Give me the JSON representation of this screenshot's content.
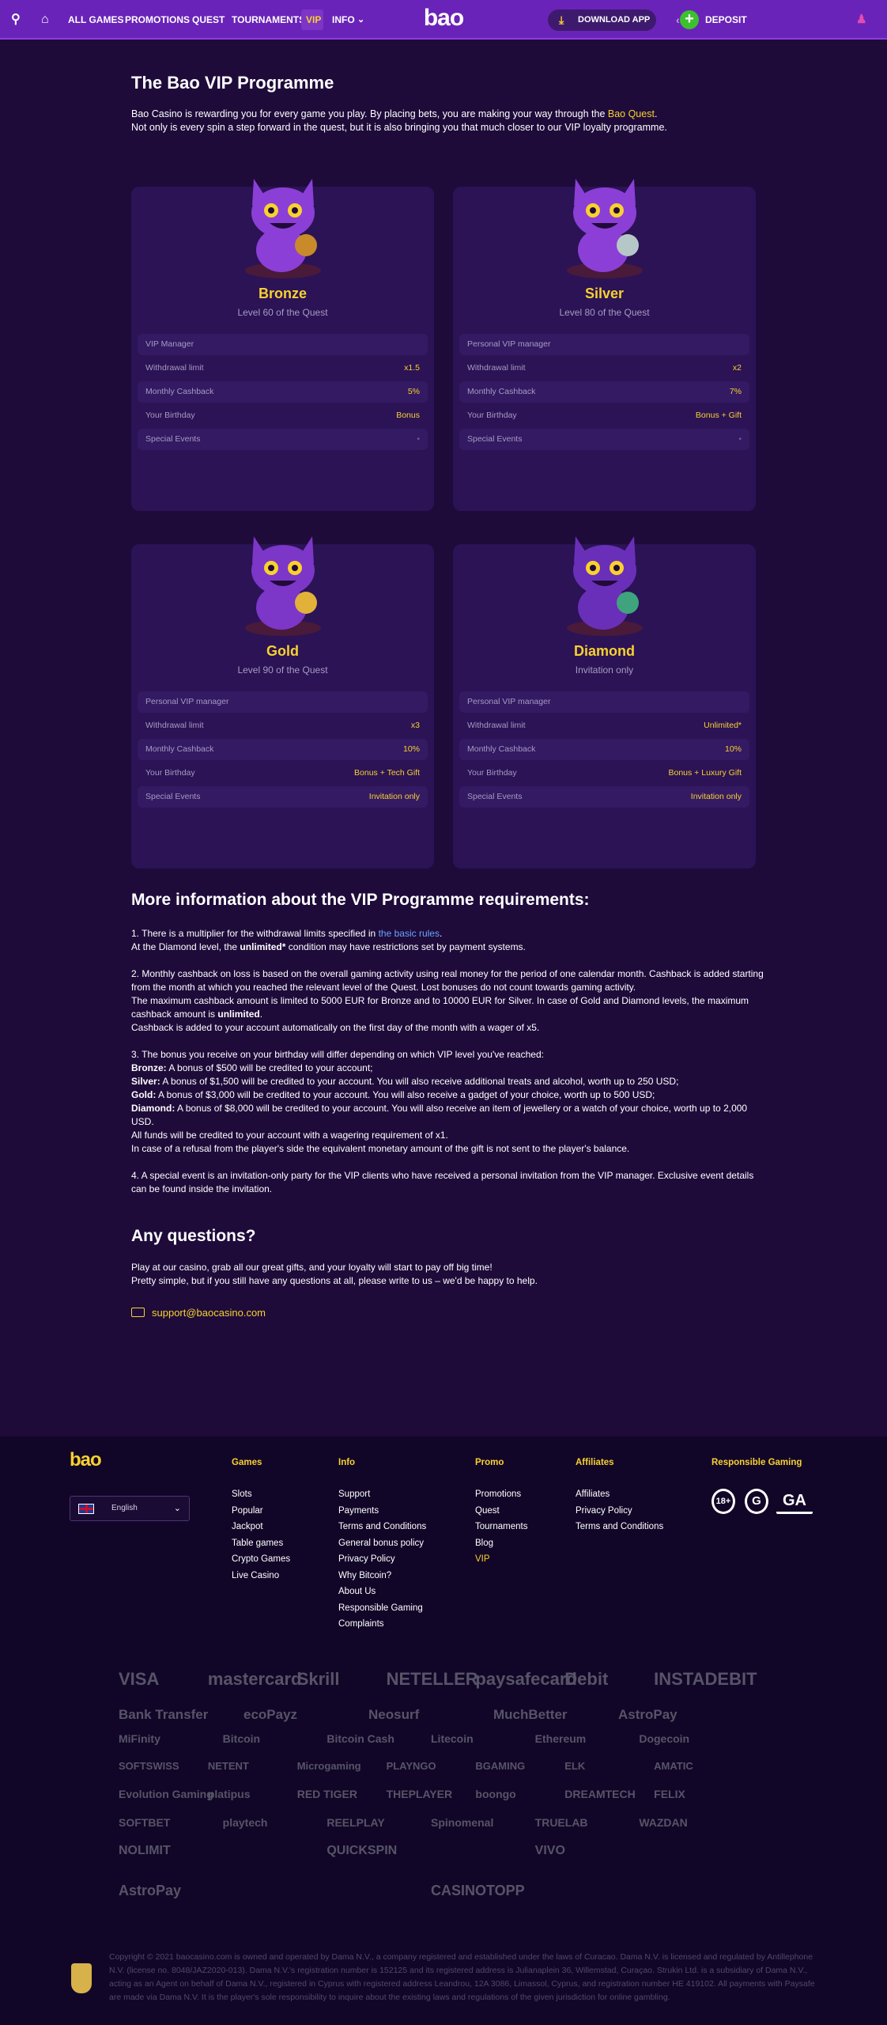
{
  "header": {
    "nav": [
      "ALL GAMES",
      "PROMOTIONS",
      "QUEST",
      "TOURNAMENTS",
      "VIP",
      "INFO"
    ],
    "logo": "bao",
    "download": "DOWNLOAD APP",
    "deposit": "DEPOSIT"
  },
  "page": {
    "title": "The Bao VIP Programme",
    "intro_1": "Bao Casino is rewarding you for every game you play. By placing bets, you are making your way through the ",
    "intro_link": "Bao Quest",
    "intro_2": "Not only is every spin a step forward in the quest, but it is also bringing you that much closer to our VIP loyalty programme."
  },
  "levels": [
    {
      "name": "Bronze",
      "sub": "Level 60 of the Quest",
      "rows": [
        [
          "VIP Manager",
          ""
        ],
        [
          "Withdrawal limit",
          "x1.5"
        ],
        [
          "Monthly Cashback",
          "5%"
        ],
        [
          "Your Birthday",
          "Bonus"
        ],
        [
          "Special Events",
          "•"
        ]
      ]
    },
    {
      "name": "Silver",
      "sub": "Level 80 of the Quest",
      "rows": [
        [
          "Personal VIP manager",
          ""
        ],
        [
          "Withdrawal limit",
          "x2"
        ],
        [
          "Monthly Cashback",
          "7%"
        ],
        [
          "Your Birthday",
          "Bonus + Gift"
        ],
        [
          "Special Events",
          "•"
        ]
      ]
    },
    {
      "name": "Gold",
      "sub": "Level 90 of the Quest",
      "rows": [
        [
          "Personal VIP manager",
          ""
        ],
        [
          "Withdrawal limit",
          "x3"
        ],
        [
          "Monthly Cashback",
          "10%"
        ],
        [
          "Your Birthday",
          "Bonus + Tech Gift"
        ],
        [
          "Special Events",
          "Invitation only"
        ]
      ]
    },
    {
      "name": "Diamond",
      "sub": "Invitation only",
      "rows": [
        [
          "Personal VIP manager",
          ""
        ],
        [
          "Withdrawal limit",
          "Unlimited*"
        ],
        [
          "Monthly Cashback",
          "10%"
        ],
        [
          "Your Birthday",
          "Bonus + Luxury Gift"
        ],
        [
          "Special Events",
          "Invitation only"
        ]
      ]
    }
  ],
  "requirements": {
    "title": "More information about the VIP Programme requirements:",
    "p1a": "1. There is a multiplier for the withdrawal limits specified in ",
    "p1link": "the basic rules",
    "p1b": "At the Diamond level, the ",
    "p1bold": "unlimited*",
    "p1c": " condition may have restrictions set by payment systems.",
    "p2a": "2. Monthly cashback on loss is based on the overall gaming activity using real money for the period of one calendar month. Cashback is added starting from the month at which you reached the relevant level of the Quest. Lost bonuses do not count towards gaming activity.",
    "p2b": "The maximum cashback amount is limited to 5000 EUR for Bronze and to 10000 EUR for Silver. In case of Gold and Diamond levels, the maximum cashback amount is ",
    "p2bold": "unlimited",
    "p2c": "Cashback is added to your account automatically on the first day of the month with a wager of x5.",
    "p3": "3. The bonus you receive on your birthday will differ depending on which VIP level you've reached:",
    "b1k": "Bronze:",
    "b1": " A bonus of $500 will be credited to your account;",
    "b2k": "Silver:",
    "b2": " A bonus of $1,500 will be credited to your account. You will also receive additional treats and alcohol, worth up to 250 USD;",
    "b3k": "Gold:",
    "b3": " A bonus of $3,000 will be credited to your account. You will also receive a gadget of your choice, worth up to 500 USD;",
    "b4k": "Diamond:",
    "b4": " A bonus of $8,000 will be credited to your account. You will also receive an item of jewellery or a watch of your choice, worth up to 2,000 USD.",
    "p3b": "All funds will be credited to your account with a wagering requirement of x1.",
    "p3c": "In case of a refusal from the player's side the equivalent monetary amount of the gift is not sent to the player's balance.",
    "p4": "4. A special event is an invitation-only party for the VIP clients who have received a personal invitation from the VIP manager. Exclusive event details can be found inside the invitation."
  },
  "questions": {
    "title": "Any questions?",
    "l1": "Play at our casino, grab all our great gifts, and your loyalty will start to pay off big time!",
    "l2": "Pretty simple, but if you still have any questions at all, please write to us – we'd be happy to help.",
    "email": "support@baocasino.com"
  },
  "footer": {
    "logo": "bao",
    "language": "English",
    "games": {
      "title": "Games",
      "items": [
        "Slots",
        "Popular",
        "Jackpot",
        "Table games",
        "Crypto Games",
        "Live Casino"
      ]
    },
    "info": {
      "title": "Info",
      "items": [
        "Support",
        "Payments",
        "Terms and Conditions",
        "General bonus policy",
        "Privacy Policy",
        "Why Bitcoin?",
        "About Us",
        "Responsible Gaming",
        "Complaints"
      ]
    },
    "promo": {
      "title": "Promo",
      "items": [
        "Promotions",
        "Quest",
        "Tournaments",
        "Blog",
        "VIP"
      ]
    },
    "affiliates": {
      "title": "Affiliates",
      "items": [
        "Affiliates",
        "Privacy Policy",
        "Terms and Conditions"
      ]
    },
    "responsible": {
      "title": "Responsible Gaming",
      "badges": [
        "18+",
        "GA"
      ]
    },
    "providers": [
      "VISA",
      "mastercard",
      "Skrill",
      "NETELLER",
      "paysafecard",
      "Debit",
      "INSTADEBIT",
      "Bank Transfer",
      "ecoPayz",
      "Neosurf",
      "MuchBetter",
      "AstroPay",
      "MiFinity",
      "Bitcoin",
      "Bitcoin Cash",
      "Litecoin",
      "Ethereum",
      "Dogecoin",
      "SOFTSWISS",
      "NETENT",
      "Microgaming",
      "PLAYNGO",
      "BGAMING",
      "ELK",
      "AMATIC",
      "Evolution Gaming",
      "platipus",
      "RED TIGER",
      "THEPLAYER",
      "boongo",
      "DREAMTECH",
      "FELIX",
      "SOFTBET",
      "playtech",
      "REELPLAY",
      "Spinomenal",
      "TRUELAB",
      "WAZDAN",
      "NOLIMIT",
      "QUICKSPIN",
      "VIVO",
      "AstroPay",
      "CASINOTOPP"
    ],
    "copyright": "Copyright © 2021 baocasino.com is owned and operated by Dama N.V., a company registered and established under the laws of Curacao. Dama N.V. is licensed and regulated by Antillephone N.V. (license no. 8048/JAZ2020-013). Dama N.V.'s registration number is 152125 and its registered address is Julianaplein 36, Willemstad, Curaçao. Strukin Ltd. is a subsidiary of Dama N.V., acting as an Agent on behalf of Dama N.V., registered in Cyprus with registered address Leandrou, 12A 3086, Limassol, Cyprus, and registration number HE 419102. All payments with Paysafe are made via Dama N.V. It is the player's sole responsibility to inquire about the existing laws and regulations of the given jurisdiction for online gambling."
  },
  "colors": {
    "header": "#6a23b8",
    "bg": "#1e0b3a",
    "card": "#2b1356",
    "accent": "#f8d12f",
    "footer": "#120628"
  }
}
